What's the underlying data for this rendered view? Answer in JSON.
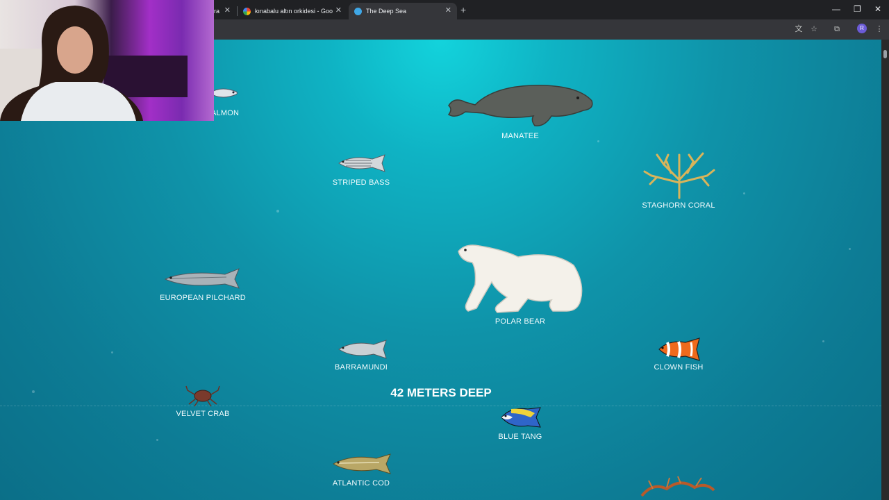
{
  "browser": {
    "tabs": [
      {
        "title": "ra",
        "active": false
      },
      {
        "title": "kınabalu altın orkidesi - Google",
        "active": false
      },
      {
        "title": "The Deep Sea",
        "active": true
      }
    ],
    "new_tab": "+",
    "window_controls": {
      "minimize": "—",
      "restore": "❐",
      "close": "✕"
    },
    "profile_initial": "R"
  },
  "page": {
    "depth_label": "42 METERS DEEP",
    "creatures": [
      {
        "key": "salmon",
        "label": "ALMON"
      },
      {
        "key": "manatee",
        "label": "MANATEE"
      },
      {
        "key": "striped_bass",
        "label": "STRIPED BASS"
      },
      {
        "key": "staghorn_coral",
        "label": "STAGHORN CORAL"
      },
      {
        "key": "european_pilchard",
        "label": "EUROPEAN PILCHARD"
      },
      {
        "key": "polar_bear",
        "label": "POLAR BEAR"
      },
      {
        "key": "barramundi",
        "label": "BARRAMUNDI"
      },
      {
        "key": "clown_fish",
        "label": "CLOWN FISH"
      },
      {
        "key": "velvet_crab",
        "label": "VELVET CRAB"
      },
      {
        "key": "blue_tang",
        "label": "BLUE TANG"
      },
      {
        "key": "atlantic_cod",
        "label": "ATLANTIC COD"
      }
    ]
  },
  "colors": {
    "water_top": "#13d3dc",
    "water_bottom": "#0b6f88",
    "label": "#f2fbfd"
  }
}
